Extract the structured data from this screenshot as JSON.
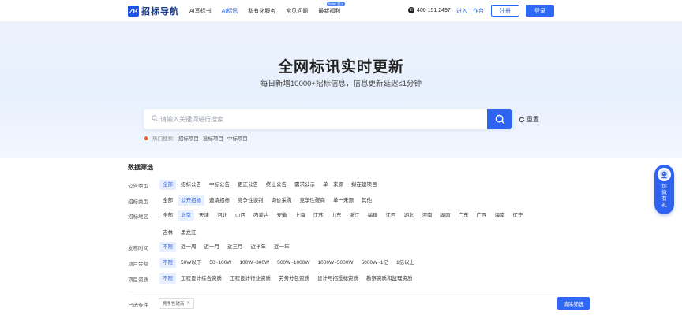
{
  "nav": {
    "logo_mark": "ZB",
    "logo_text": "招标导航",
    "links": [
      "AI写标书",
      "AI标讯",
      "私有化服务",
      "常见问题",
      "最新福利"
    ],
    "badge": "Safari 提示",
    "phone": "400 151 2497",
    "workbench": "进入工作台",
    "register": "注册",
    "login": "登录"
  },
  "hero": {
    "title": "全网标讯实时更新",
    "subtitle": "每日新增10000+招标信息，信息更新延迟≤1分钟"
  },
  "search": {
    "placeholder": "请输入关键词进行搜索",
    "reset": "重置"
  },
  "hot": {
    "label": "热门搜索:",
    "items": [
      "招标项目",
      "投标项目",
      "中标项目"
    ]
  },
  "filter": {
    "title": "数据筛选",
    "rows": [
      {
        "label": "公告类型",
        "options": [
          "全部",
          "招标公告",
          "中标公告",
          "更正公告",
          "终止公告",
          "需求公示",
          "单一来源",
          "拟在建项目"
        ],
        "selected": 0
      },
      {
        "label": "招标类型",
        "options": [
          "全部",
          "公开招标",
          "邀请招标",
          "竞争性谈判",
          "询价采购",
          "竞争性磋商",
          "单一来源",
          "其他"
        ],
        "selected": 1
      },
      {
        "label": "招标地区",
        "options": [
          "全部",
          "北京",
          "天津",
          "河北",
          "山西",
          "内蒙古",
          "安徽",
          "上海",
          "江苏",
          "山东",
          "浙江",
          "福建",
          "江西",
          "湖北",
          "河南",
          "湖南",
          "广东",
          "广西",
          "海南",
          "辽宁",
          "吉林",
          "黑龙江"
        ],
        "selected": 1
      },
      {
        "label": "发布时间",
        "options": [
          "不限",
          "近一周",
          "近一月",
          "近三月",
          "近半年",
          "近一年"
        ],
        "selected": 0
      },
      {
        "label": "项目金额",
        "options": [
          "不限",
          "50W以下",
          "50~100W",
          "100W~300W",
          "500W~1000W",
          "1000W~5000W",
          "5000W~1亿",
          "1亿以上"
        ],
        "selected": 0
      },
      {
        "label": "项目资质",
        "options": [
          "不限",
          "工程设计综合资质",
          "工程设计行业资质",
          "劳务分包资质",
          "设计与招投标资质",
          "勘察资质和监理资质"
        ],
        "selected": 0
      }
    ]
  },
  "selected": {
    "label": "已选条件",
    "tag": "竞争性磋商",
    "clear": "清除筛选"
  },
  "float": {
    "text": "加微有礼"
  },
  "colors": {
    "primary": "#2e68f4",
    "selected_bg": "#e8efff"
  }
}
